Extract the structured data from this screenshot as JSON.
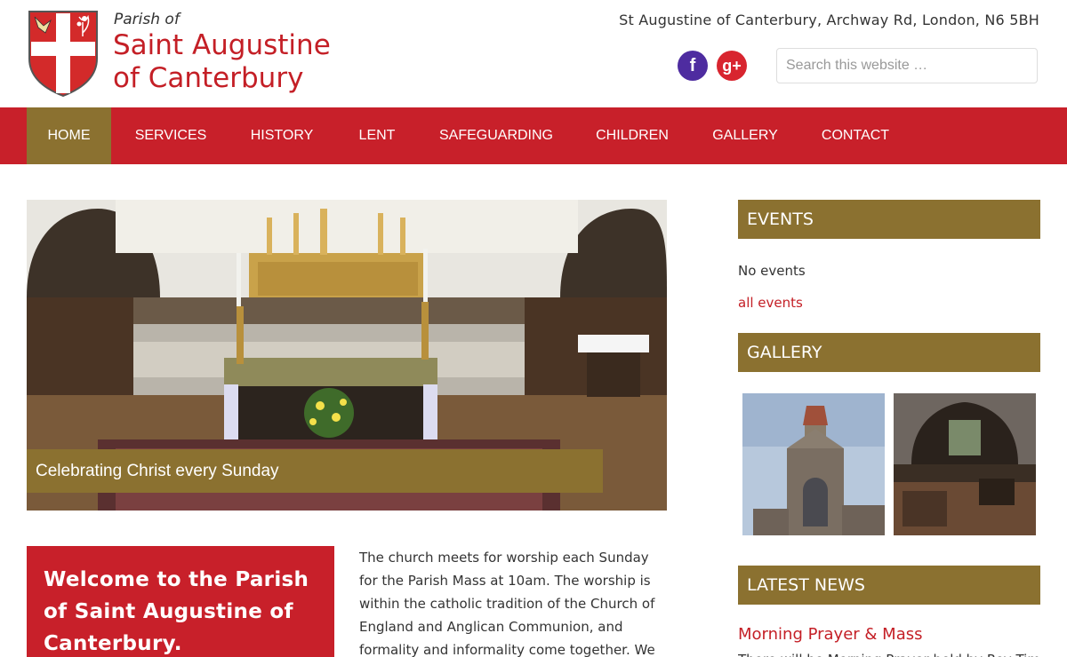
{
  "header": {
    "brand_small": "Parish of",
    "brand_line1": "Saint Augustine",
    "brand_line2": "of Canterbury",
    "address": "St Augustine of Canterbury, Archway Rd, London, N6 5BH",
    "search_placeholder": "Search this website …",
    "social": [
      {
        "name": "facebook-icon",
        "glyph": "f",
        "color": "#4e2ca0"
      },
      {
        "name": "google-plus-icon",
        "glyph": "g+",
        "color": "#d8252f"
      }
    ]
  },
  "nav": {
    "items": [
      "HOME",
      "SERVICES",
      "HISTORY",
      "LENT",
      "SAFEGUARDING",
      "CHILDREN",
      "GALLERY",
      "CONTACT"
    ],
    "active": "HOME"
  },
  "hero": {
    "caption": "Celebrating Christ every Sunday"
  },
  "welcome": {
    "heading": "Welcome to the Parish of Saint Augustine of Canterbury."
  },
  "intro": {
    "text": "The church meets for worship each Sunday for the Parish Mass at 10am. The worship is within the catholic tradition of the Church of England and Anglican Communion, and formality and informality come together. We welcome and"
  },
  "sidebar": {
    "events_title": "EVENTS",
    "no_events": "No events",
    "all_events": "all events",
    "gallery_title": "GALLERY",
    "news_title": "LATEST NEWS",
    "news_item_title": "Morning Prayer & Mass",
    "news_item_excerpt": "There will be Morning Prayer held by Rev Tim"
  },
  "colors": {
    "brand_red": "#c8202a",
    "gold": "#8b7130",
    "active_nav": "#8b7130"
  }
}
